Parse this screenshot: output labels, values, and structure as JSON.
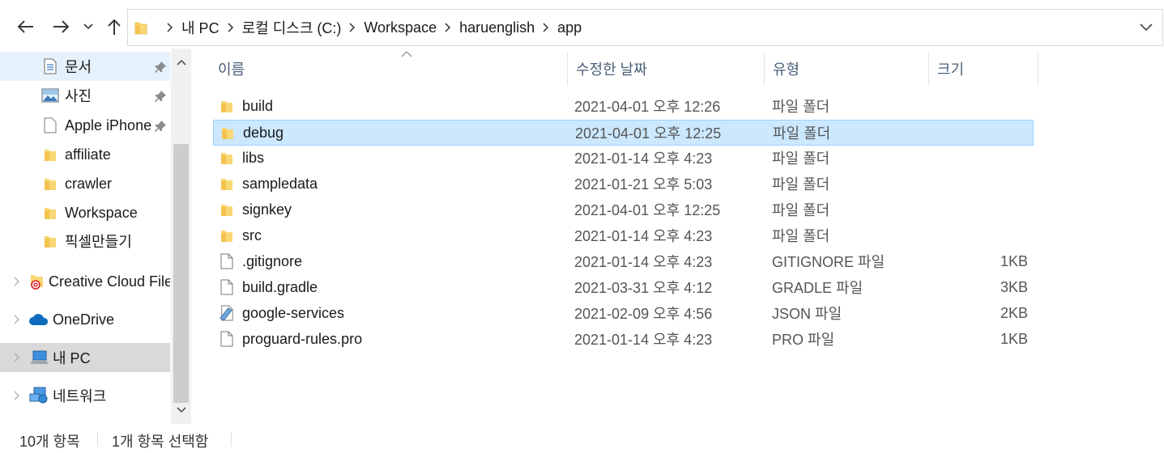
{
  "address_bar": {
    "crumbs": [
      "내 PC",
      "로컬 디스크 (C:)",
      "Workspace",
      "haruenglish",
      "app"
    ]
  },
  "sidebar": {
    "items": [
      {
        "label": "문서",
        "icon": "document-icon",
        "pinned": true
      },
      {
        "label": "사진",
        "icon": "pictures-icon",
        "pinned": true
      },
      {
        "label": "Apple iPhone",
        "icon": "blank-file-icon",
        "pinned": true
      },
      {
        "label": "affiliate",
        "icon": "folder-icon",
        "pinned": false
      },
      {
        "label": "crawler",
        "icon": "folder-icon",
        "pinned": false
      },
      {
        "label": "Workspace",
        "icon": "folder-icon",
        "pinned": false
      },
      {
        "label": "픽셀만들기",
        "icon": "folder-icon",
        "pinned": false
      },
      {
        "label": "Creative Cloud Files",
        "icon": "creative-cloud-folder-icon"
      },
      {
        "label": "OneDrive",
        "icon": "onedrive-icon"
      },
      {
        "label": "내 PC",
        "icon": "this-pc-icon"
      },
      {
        "label": "네트워크",
        "icon": "network-icon"
      }
    ]
  },
  "columns": {
    "name": "이름",
    "date": "수정한 날짜",
    "type": "유형",
    "size": "크기"
  },
  "files": [
    {
      "name": "build",
      "date": "2021-04-01 오후 12:26",
      "type": "파일 폴더",
      "size": "",
      "icon": "folder-icon"
    },
    {
      "name": "debug",
      "date": "2021-04-01 오후 12:25",
      "type": "파일 폴더",
      "size": "",
      "icon": "folder-icon",
      "selected": true
    },
    {
      "name": "libs",
      "date": "2021-01-14 오후 4:23",
      "type": "파일 폴더",
      "size": "",
      "icon": "folder-icon"
    },
    {
      "name": "sampledata",
      "date": "2021-01-21 오후 5:03",
      "type": "파일 폴더",
      "size": "",
      "icon": "folder-icon"
    },
    {
      "name": "signkey",
      "date": "2021-04-01 오후 12:25",
      "type": "파일 폴더",
      "size": "",
      "icon": "folder-icon"
    },
    {
      "name": "src",
      "date": "2021-01-14 오후 4:23",
      "type": "파일 폴더",
      "size": "",
      "icon": "folder-icon"
    },
    {
      "name": ".gitignore",
      "date": "2021-01-14 오후 4:23",
      "type": "GITIGNORE 파일",
      "size": "1KB",
      "icon": "file-icon"
    },
    {
      "name": "build.gradle",
      "date": "2021-03-31 오후 4:12",
      "type": "GRADLE 파일",
      "size": "3KB",
      "icon": "file-icon"
    },
    {
      "name": "google-services",
      "date": "2021-02-09 오후 4:56",
      "type": "JSON 파일",
      "size": "2KB",
      "icon": "json-file-icon"
    },
    {
      "name": "proguard-rules.pro",
      "date": "2021-01-14 오후 4:23",
      "type": "PRO 파일",
      "size": "1KB",
      "icon": "file-icon"
    }
  ],
  "status": {
    "count": "10개 항목",
    "selected": "1개 항목 선택함"
  },
  "colors": {
    "selection_bg": "#cce8ff",
    "selection_border": "#99d1ff",
    "folder_yellow": "#f8d775",
    "header_text": "#4c607a"
  }
}
